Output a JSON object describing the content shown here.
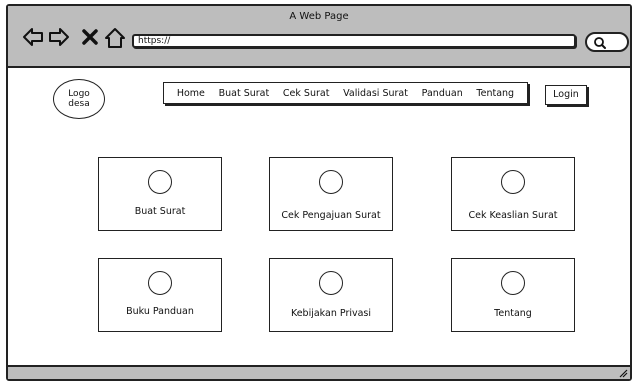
{
  "browser": {
    "title": "A Web Page",
    "url": "https://",
    "icons": [
      "back-arrow-icon",
      "forward-arrow-icon",
      "close-x-icon",
      "home-icon",
      "search-icon"
    ]
  },
  "header": {
    "logo_line1": "Logo",
    "logo_line2": "desa",
    "menu": [
      "Home",
      "Buat Surat",
      "Cek Surat",
      "Validasi Surat",
      "Panduan",
      "Tentang"
    ],
    "login_label": "Login"
  },
  "cards": [
    {
      "label": "Buat Surat"
    },
    {
      "label": "Cek Pengajuan Surat"
    },
    {
      "label": "Cek Keaslian Surat"
    },
    {
      "label": "Buku Panduan"
    },
    {
      "label": "Kebijakan Privasi"
    },
    {
      "label": "Tentang"
    }
  ]
}
